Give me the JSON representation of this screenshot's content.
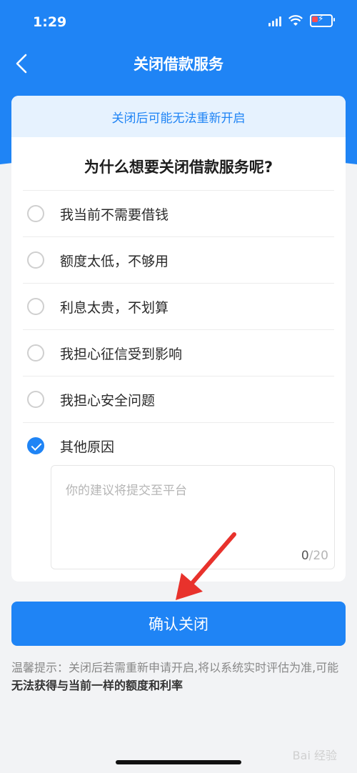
{
  "status_bar": {
    "time": "1:29"
  },
  "nav": {
    "title": "关闭借款服务"
  },
  "warning": "关闭后可能无法重新开启",
  "question": "为什么想要关闭借款服务呢?",
  "options": [
    {
      "label": "我当前不需要借钱",
      "checked": false
    },
    {
      "label": "额度太低，不够用",
      "checked": false
    },
    {
      "label": "利息太贵，不划算",
      "checked": false
    },
    {
      "label": "我担心征信受到影响",
      "checked": false
    },
    {
      "label": "我担心安全问题",
      "checked": false
    },
    {
      "label": "其他原因",
      "checked": true
    }
  ],
  "feedback": {
    "placeholder": "你的建议将提交至平台",
    "count_current": "0",
    "count_max": "/20"
  },
  "confirm_button": "确认关闭",
  "tip": {
    "prefix": "温馨提示：关闭后若需重新申请开启,将以系统实时评估为准,可能",
    "bold": "无法获得与当前一样的额度和利率"
  },
  "watermark": "Bai 经验",
  "colors": {
    "primary": "#1f84f5",
    "warning_bg": "#e6f2fe",
    "annotation_arrow": "#e8322c"
  }
}
